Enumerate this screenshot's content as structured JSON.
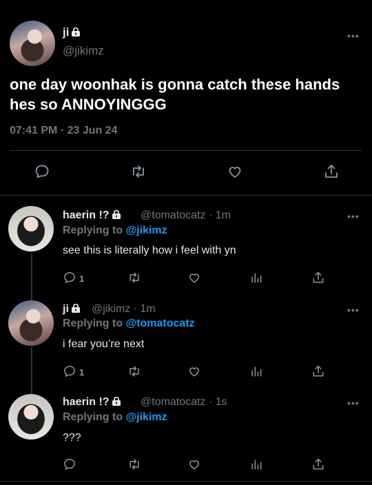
{
  "main_tweet": {
    "display_name": "ji",
    "handle": "@jikimz",
    "text": "one day woonhak is gonna catch these hands hes so ANNOYINGGG",
    "timestamp": "07:41 PM · 23 Jun 24",
    "more_label": "•••"
  },
  "replies": [
    {
      "display_name": "haerin !?",
      "handle": "@tomatocatz · 1m",
      "replying_prefix": "Replying to",
      "replying_to": "@jikimz",
      "text": "see this is literally how i feel with yn",
      "reply_count": "1",
      "more_label": "•••"
    },
    {
      "display_name": "ji",
      "handle": "@jikimz · 1m",
      "replying_prefix": "Replying to",
      "replying_to": "@tomatocatz",
      "text": "i fear you’re next",
      "reply_count": "1",
      "more_label": "•••"
    },
    {
      "display_name": "haerin !?",
      "handle": "@tomatocatz · 1s",
      "replying_prefix": "Replying to",
      "replying_to": "@jikimz",
      "text": "???",
      "reply_count": "",
      "more_label": "•••"
    }
  ],
  "colors": {
    "background": "#000000",
    "accent": "#1d9bf0",
    "muted": "#71767b",
    "text": "#e7e9ea"
  },
  "icons": {
    "main_actions": [
      "reply-icon",
      "retweet-icon",
      "like-icon",
      "share-icon"
    ],
    "reply_actions": [
      "reply-icon",
      "retweet-icon",
      "like-icon",
      "analytics-icon",
      "share-icon"
    ],
    "badge": "lock-icon"
  }
}
